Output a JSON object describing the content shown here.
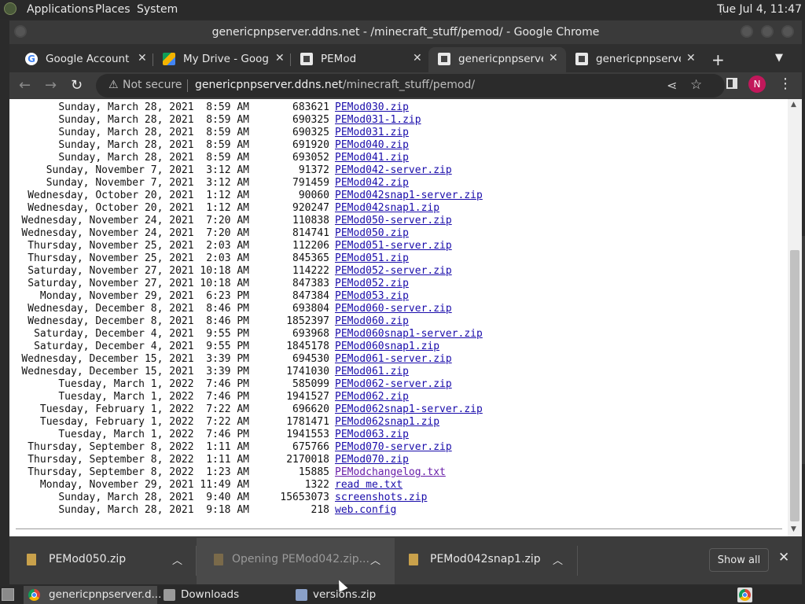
{
  "top_panel": {
    "menus": [
      "Applications",
      "Places",
      "System"
    ],
    "clock": "Tue Jul  4, 11:47"
  },
  "window": {
    "title": "genericpnpserver.ddns.net - /minecraft_stuff/pemod/ - Google Chrome"
  },
  "tabs": [
    {
      "label": "Google Account",
      "icon": "google-g-icon",
      "active": false
    },
    {
      "label": "My Drive - Google D",
      "icon": "google-drive-icon",
      "active": false
    },
    {
      "label": "PEMod",
      "icon": "page-icon",
      "active": false
    },
    {
      "label": "genericpnpserver.d",
      "icon": "page-icon",
      "active": true
    },
    {
      "label": "genericpnpserver.d",
      "icon": "page-icon",
      "active": false
    }
  ],
  "toolbar": {
    "not_secure": "Not secure",
    "url_host": "genericpnpserver.ddns.net",
    "url_path": "/minecraft_stuff/pemod/",
    "avatar_letter": "N"
  },
  "listing": [
    {
      "date": "Sunday, March 28, 2021  8:59 AM",
      "size": "683621",
      "name": "PEMod030.zip"
    },
    {
      "date": "Sunday, March 28, 2021  8:59 AM",
      "size": "690325",
      "name": "PEMod031-1.zip"
    },
    {
      "date": "Sunday, March 28, 2021  8:59 AM",
      "size": "690325",
      "name": "PEMod031.zip"
    },
    {
      "date": "Sunday, March 28, 2021  8:59 AM",
      "size": "691920",
      "name": "PEMod040.zip"
    },
    {
      "date": "Sunday, March 28, 2021  8:59 AM",
      "size": "693052",
      "name": "PEMod041.zip"
    },
    {
      "date": "Sunday, November 7, 2021  3:12 AM",
      "size": "91372",
      "name": "PEMod042-server.zip"
    },
    {
      "date": "Sunday, November 7, 2021  3:12 AM",
      "size": "791459",
      "name": "PEMod042.zip"
    },
    {
      "date": "Wednesday, October 20, 2021  1:12 AM",
      "size": "90060",
      "name": "PEMod042snap1-server.zip"
    },
    {
      "date": "Wednesday, October 20, 2021  1:12 AM",
      "size": "920247",
      "name": "PEMod042snap1.zip"
    },
    {
      "date": "Wednesday, November 24, 2021  7:20 AM",
      "size": "110838",
      "name": "PEMod050-server.zip"
    },
    {
      "date": "Wednesday, November 24, 2021  7:20 AM",
      "size": "814741",
      "name": "PEMod050.zip"
    },
    {
      "date": "Thursday, November 25, 2021  2:03 AM",
      "size": "112206",
      "name": "PEMod051-server.zip"
    },
    {
      "date": "Thursday, November 25, 2021  2:03 AM",
      "size": "845365",
      "name": "PEMod051.zip"
    },
    {
      "date": "Saturday, November 27, 2021 10:18 AM",
      "size": "114222",
      "name": "PEMod052-server.zip"
    },
    {
      "date": "Saturday, November 27, 2021 10:18 AM",
      "size": "847383",
      "name": "PEMod052.zip"
    },
    {
      "date": "Monday, November 29, 2021  6:23 PM",
      "size": "847384",
      "name": "PEMod053.zip"
    },
    {
      "date": "Wednesday, December 8, 2021  8:46 PM",
      "size": "693804",
      "name": "PEMod060-server.zip"
    },
    {
      "date": "Wednesday, December 8, 2021  8:46 PM",
      "size": "1852397",
      "name": "PEMod060.zip"
    },
    {
      "date": "Saturday, December 4, 2021  9:55 PM",
      "size": "693968",
      "name": "PEMod060snap1-server.zip"
    },
    {
      "date": "Saturday, December 4, 2021  9:55 PM",
      "size": "1845178",
      "name": "PEMod060snap1.zip"
    },
    {
      "date": "Wednesday, December 15, 2021  3:39 PM",
      "size": "694530",
      "name": "PEMod061-server.zip"
    },
    {
      "date": "Wednesday, December 15, 2021  3:39 PM",
      "size": "1741030",
      "name": "PEMod061.zip"
    },
    {
      "date": "Tuesday, March 1, 2022  7:46 PM",
      "size": "585099",
      "name": "PEMod062-server.zip"
    },
    {
      "date": "Tuesday, March 1, 2022  7:46 PM",
      "size": "1941527",
      "name": "PEMod062.zip"
    },
    {
      "date": "Tuesday, February 1, 2022  7:22 AM",
      "size": "696620",
      "name": "PEMod062snap1-server.zip"
    },
    {
      "date": "Tuesday, February 1, 2022  7:22 AM",
      "size": "1781471",
      "name": "PEMod062snap1.zip"
    },
    {
      "date": "Tuesday, March 1, 2022  7:46 PM",
      "size": "1941553",
      "name": "PEMod063.zip"
    },
    {
      "date": "Thursday, September 8, 2022  1:11 AM",
      "size": "675766",
      "name": "PEMod070-server.zip"
    },
    {
      "date": "Thursday, September 8, 2022  1:11 AM",
      "size": "2170018",
      "name": "PEMod070.zip"
    },
    {
      "date": "Thursday, September 8, 2022  1:23 AM",
      "size": "15885",
      "name": "PEModchangelog.txt",
      "visited": true
    },
    {
      "date": "Monday, November 29, 2021 11:49 AM",
      "size": "1322",
      "name": "read me.txt"
    },
    {
      "date": "Sunday, March 28, 2021  9:40 AM",
      "size": "15653073",
      "name": "screenshots.zip"
    },
    {
      "date": "Sunday, March 28, 2021  9:18 AM",
      "size": "218",
      "name": "web.config"
    }
  ],
  "downloads": [
    {
      "label": "PEMod050.zip",
      "state": "done"
    },
    {
      "label": "Opening PEMod042.zip...",
      "state": "opening"
    },
    {
      "label": "PEMod042snap1.zip",
      "state": "done"
    }
  ],
  "shelf": {
    "show_all": "Show all"
  },
  "taskbar": [
    {
      "label": "genericpnpserver.d...",
      "icon": "chrome-icon",
      "active": true
    },
    {
      "label": "Downloads",
      "icon": "folder-icon",
      "active": false
    },
    {
      "label": "versions.zip",
      "icon": "archive-icon",
      "active": false
    }
  ]
}
